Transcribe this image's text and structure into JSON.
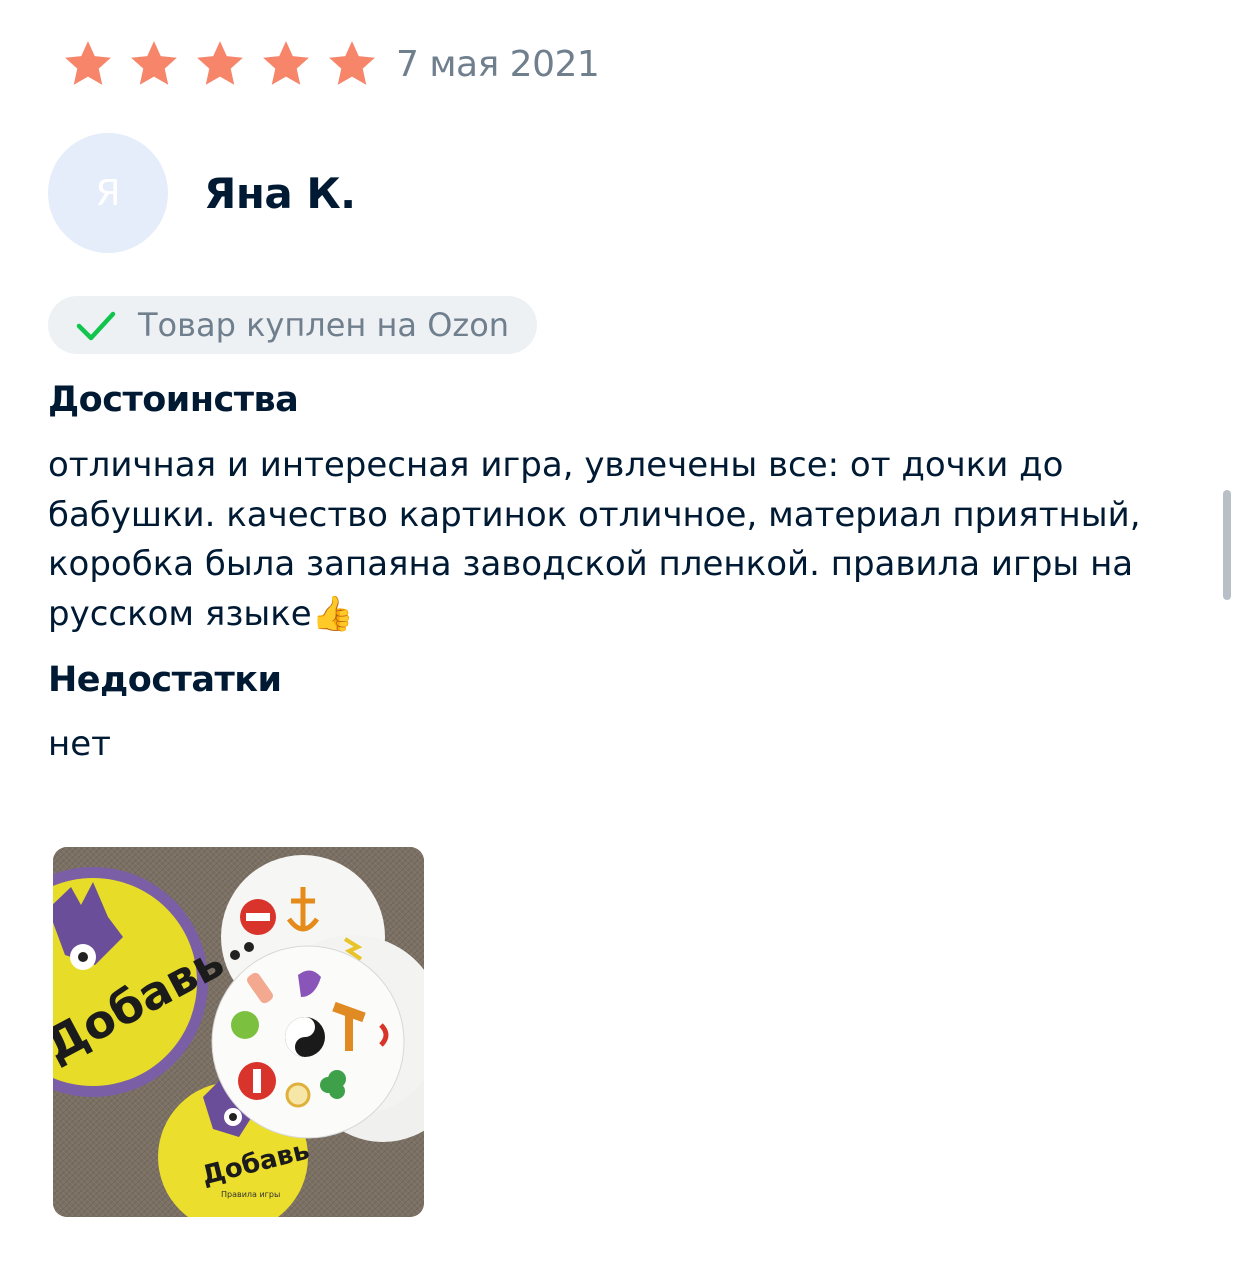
{
  "review": {
    "rating": 5,
    "rating_max": 5,
    "star_color": "#f6856a",
    "date": "7 мая 2021",
    "author": {
      "initial": "Я",
      "name": "Яна К."
    },
    "verified_label": "Товар куплен на Ozon",
    "verified_icon": "checkmark-icon",
    "verified_color": "#10c44c",
    "pros": {
      "title": "Достоинства",
      "text": "отличная и интересная игра, увлечены все: от дочки до бабушки. качество картинок отличное, материал приятный, коробка была запаяна заводской пленкой. правила игры на русском языке👍"
    },
    "cons": {
      "title": "Недостатки",
      "text": "нет"
    },
    "photo": {
      "icon": "review-photo",
      "box_text": "Добавь",
      "manual_text": "Правила игры"
    }
  }
}
